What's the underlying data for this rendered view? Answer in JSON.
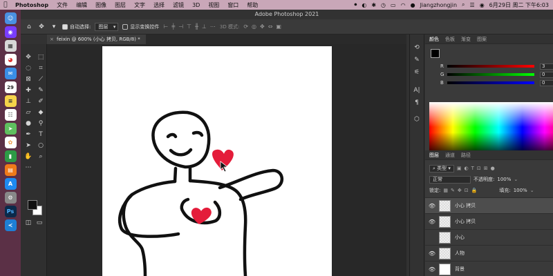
{
  "menubar": {
    "app": "Photoshop",
    "items": [
      "文件",
      "编辑",
      "图像",
      "图层",
      "文字",
      "选择",
      "滤镜",
      "3D",
      "视图",
      "窗口",
      "帮助"
    ],
    "user": "Jiangzhongjin",
    "datetime": "6月29日 周二 下午6:03"
  },
  "window": {
    "title": "Adobe Photoshop 2021"
  },
  "options": {
    "auto_select_label": "自动选择:",
    "auto_select_value": "图层",
    "transform_label": "显示变换控件",
    "mode_3d": "3D 模式:"
  },
  "document": {
    "tab_title": "feixin @ 600% (小心 拷贝, RGB/8) *"
  },
  "color_panel": {
    "tabs": [
      "颜色",
      "色板",
      "渐变",
      "图案"
    ],
    "r_label": "R",
    "g_label": "G",
    "b_label": "B",
    "r": "3",
    "g": "0",
    "b": "0"
  },
  "layers_panel": {
    "tabs": [
      "图层",
      "通道",
      "路径"
    ],
    "filter": "类型",
    "blend_mode": "正常",
    "opacity_label": "不透明度:",
    "opacity": "100%",
    "lock_label": "锁定:",
    "fill_label": "填充:",
    "fill": "100%",
    "layers": [
      {
        "name": "小心 拷贝",
        "visible": true,
        "selected": true
      },
      {
        "name": "小心 拷贝",
        "visible": true,
        "selected": false
      },
      {
        "name": "小心",
        "visible": false,
        "selected": false
      },
      {
        "name": "人物",
        "visible": true,
        "selected": false
      },
      {
        "name": "背景",
        "visible": true,
        "selected": false,
        "locked": true
      }
    ]
  },
  "dock": [
    "Finder",
    "Siri",
    "Launchpad",
    "Chrome",
    "Mail",
    "Calendar",
    "Notes",
    "Reminders",
    "Maps",
    "Photos",
    "Numbers",
    "Books",
    "App Store",
    "Preferences",
    "Photoshop",
    "VS Code"
  ],
  "dock_calendar_day": "29"
}
